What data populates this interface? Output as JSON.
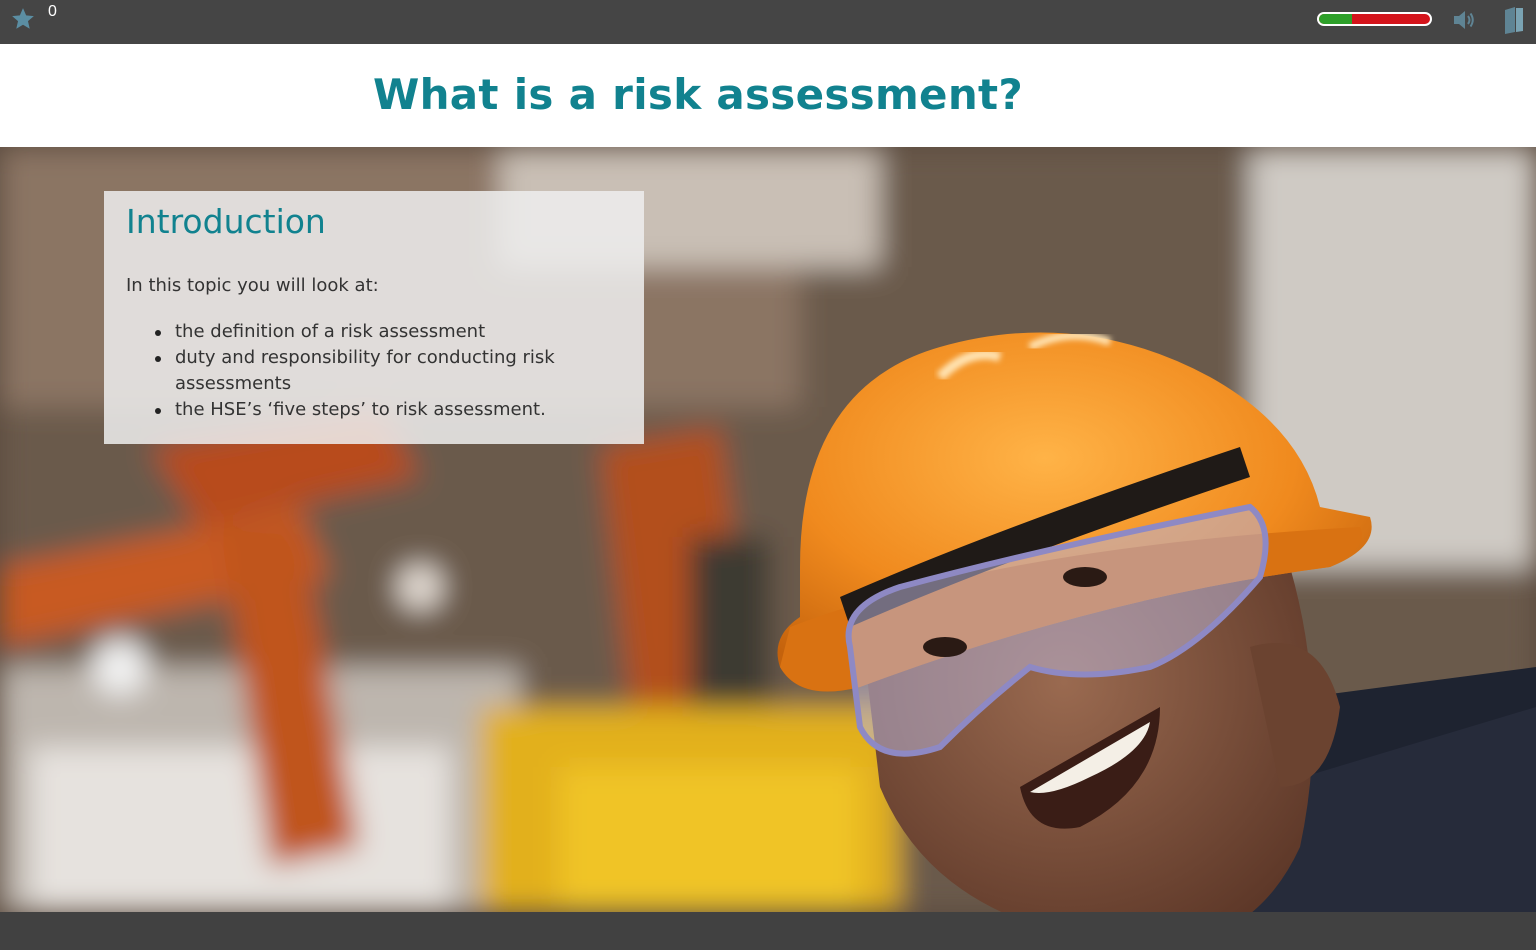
{
  "topbar": {
    "score_icon": "star-icon",
    "score": "0",
    "progress": 0.3,
    "progress_colors": {
      "done": "#2ea02a",
      "remaining": "#d4141b"
    },
    "audio_icon": "speaker-icon",
    "menu_icon": "book-icon"
  },
  "slide": {
    "title": "What is a risk assessment?",
    "intro": {
      "heading": "Introduction",
      "lead": "In this topic you will look at:",
      "items": [
        "the definition of a risk assessment",
        "duty and responsibility for conducting risk assessments",
        "the HSE’s ‘five steps’ to risk assessment."
      ]
    },
    "accent_color": "#11828f"
  }
}
